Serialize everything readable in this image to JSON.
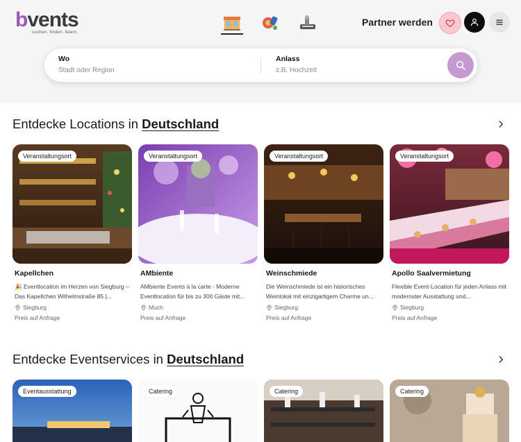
{
  "brand": {
    "logo_b": "b",
    "logo_rest": "vents",
    "tagline": "suchen. finden. feiern."
  },
  "header": {
    "category_icons": [
      "location-icon",
      "service-icon",
      "artist-icon"
    ],
    "partner_label": "Partner werden"
  },
  "search": {
    "where_label": "Wo",
    "where_placeholder": "Stadt oder Region",
    "occasion_label": "Anlass",
    "occasion_placeholder": "z.B. Hochzeit"
  },
  "locations_section": {
    "title_prefix": "Entdecke Locations in",
    "title_link": "Deutschland",
    "cards": [
      {
        "badge": "Veranstaltungsort",
        "title": "Kapellchen",
        "desc": "🎉 Eventlocation im Herzen von Siegburg – Das Kapellchen Wilhelmstraße 85 |...",
        "location": "Siegburg",
        "price": "Preis auf Anfrage"
      },
      {
        "badge": "Veranstaltungsort",
        "title": "AMbiente",
        "desc": "AMbiente Events à la carte - Moderne Eventlocation für bis zu 300 Gäste mit...",
        "location": "Much",
        "price": "Preis auf Anfrage"
      },
      {
        "badge": "Veranstaltungsort",
        "title": "Weinschmiede",
        "desc": "Die Weinschmiede ist ein historisches Weinlokal mit einzigartigem Charme un...",
        "location": "Siegburg",
        "price": "Preis auf Anfrage"
      },
      {
        "badge": "Veranstaltungsort",
        "title": "Apollo Saalvermietung",
        "desc": "Flexible Event-Location für jeden Anlass mit modernster Ausstattung und...",
        "location": "Siegburg",
        "price": "Preis auf Anfrage"
      }
    ]
  },
  "services_section": {
    "title_prefix": "Entdecke Eventservices in",
    "title_link": "Deutschland",
    "cards": [
      {
        "badge": "Eventausstattung"
      },
      {
        "badge": "Catering"
      },
      {
        "badge": "Catering"
      },
      {
        "badge": "Catering"
      }
    ]
  },
  "colors": {
    "brand_purple": "#9b59b6",
    "search_button": "#c49ad1",
    "heart_bg": "#f9c9cf",
    "hero_bg": "#f5f5f5"
  }
}
